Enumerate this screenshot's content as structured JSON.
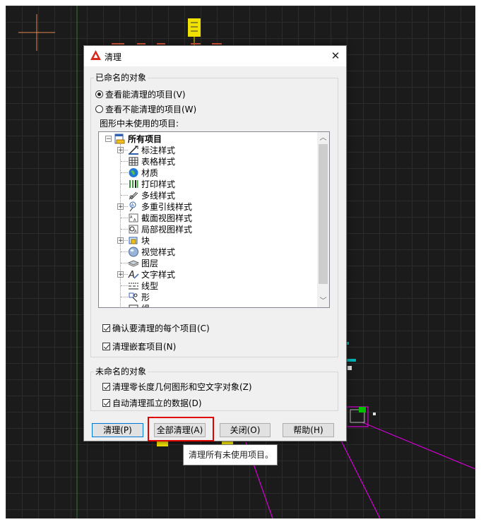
{
  "dialog": {
    "title": "清理",
    "close_glyph": "✕",
    "named_group_label": "已命名的对象",
    "radio_view_purgeable": "查看能清理的项目(V)",
    "radio_view_unpurgeable": "查看不能清理的项目(W)",
    "radio_selected": "view_purgeable",
    "tree_caption": "图形中未使用的项目:",
    "tree": {
      "root": "所有项目",
      "items": [
        {
          "label": "标注样式",
          "expandable": true,
          "icon": "dimension-style-icon"
        },
        {
          "label": "表格样式",
          "expandable": false,
          "icon": "table-style-icon"
        },
        {
          "label": "材质",
          "expandable": false,
          "icon": "material-globe-icon"
        },
        {
          "label": "打印样式",
          "expandable": false,
          "icon": "plot-style-icon"
        },
        {
          "label": "多线样式",
          "expandable": false,
          "icon": "multiline-style-icon"
        },
        {
          "label": "多重引线样式",
          "expandable": true,
          "icon": "multileader-style-icon"
        },
        {
          "label": "截面视图样式",
          "expandable": false,
          "icon": "section-view-style-icon"
        },
        {
          "label": "局部视图样式",
          "expandable": false,
          "icon": "detail-view-style-icon"
        },
        {
          "label": "块",
          "expandable": true,
          "icon": "block-icon"
        },
        {
          "label": "视觉样式",
          "expandable": false,
          "icon": "visual-style-icon"
        },
        {
          "label": "图层",
          "expandable": false,
          "icon": "layer-icon"
        },
        {
          "label": "文字样式",
          "expandable": true,
          "icon": "text-style-icon"
        },
        {
          "label": "线型",
          "expandable": false,
          "icon": "linetype-icon"
        },
        {
          "label": "形",
          "expandable": false,
          "icon": "shape-icon"
        },
        {
          "label": "组",
          "expandable": false,
          "icon": "group-icon"
        }
      ]
    },
    "check_confirm_each": "确认要清理的每个项目(C)",
    "check_confirm_each_checked": true,
    "check_nested": "清理嵌套项目(N)",
    "check_nested_checked": true,
    "unnamed_group_label": "未命名的对象",
    "check_zero_length": "清理零长度几何图形和空文字对象(Z)",
    "check_zero_length_checked": true,
    "check_orphaned": "自动清理孤立的数据(D)",
    "check_orphaned_checked": true,
    "buttons": {
      "purge": "清理(P)",
      "purge_all": "全部清理(A)",
      "close": "关闭(O)",
      "help": "帮助(H)"
    },
    "tooltip": "清理所有未使用项目。"
  },
  "colors": {
    "canvas": "#1b1b1b",
    "highlight": "#e00000",
    "magenta": "#d400d4",
    "yellow": "#f0e000"
  }
}
